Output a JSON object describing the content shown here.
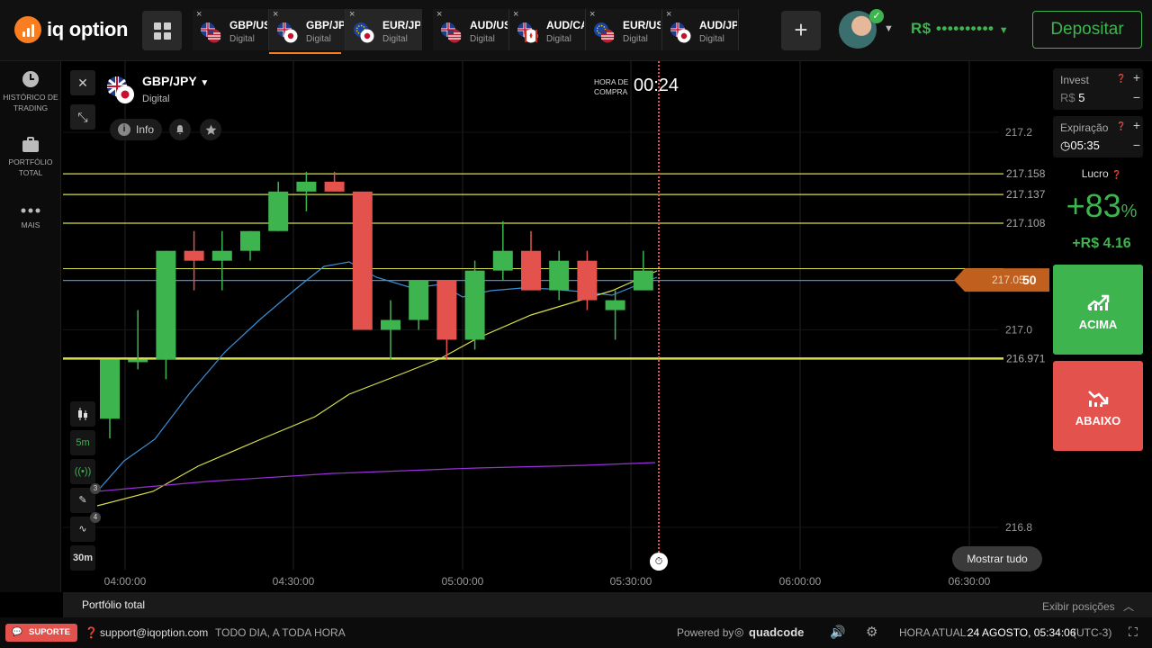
{
  "brand": {
    "name": "iq option"
  },
  "topbar": {
    "tabs": [
      {
        "pair": "GBP/USD",
        "type": "Digital",
        "flag": "gb-us",
        "state": "normal"
      },
      {
        "pair": "GBP/JPY",
        "type": "Digital",
        "flag": "gb-jp",
        "state": "active"
      },
      {
        "pair": "EUR/JPY",
        "type": "Digital",
        "flag": "eu-jp",
        "state": "hover"
      },
      {
        "pair": "AUD/USD",
        "type": "Digital",
        "flag": "au-us",
        "state": "normal"
      },
      {
        "pair": "AUD/CAD",
        "type": "Digital",
        "flag": "au-ca",
        "state": "normal"
      },
      {
        "pair": "EUR/USD",
        "type": "Digital",
        "flag": "eu-us",
        "state": "normal"
      },
      {
        "pair": "AUD/JPY",
        "type": "Digital",
        "flag": "au-jp",
        "state": "normal"
      }
    ],
    "tab_close": "×",
    "add_tab": "+",
    "balance": "R$ ••••••••••",
    "deposit": "Depositar"
  },
  "sidebar": {
    "items": [
      {
        "label": "HISTÓRICO DE TRADING",
        "icon": "clock-icon"
      },
      {
        "label": "PORTFÓLIO TOTAL",
        "icon": "briefcase-icon"
      },
      {
        "label": "MAIS",
        "icon": "more-icon"
      }
    ]
  },
  "asset": {
    "name": "GBP/JPY",
    "type": "Digital",
    "info": "Info"
  },
  "purchase": {
    "label": "HORA DE COMPRA",
    "time": "00:24"
  },
  "tools": {
    "timeframe": "5m",
    "interval": "30m",
    "draw_badge": "3",
    "indicator_badge": "4"
  },
  "chart_data": {
    "type": "candlestick",
    "x_ticks": [
      "04:00:00",
      "04:30:00",
      "05:00:00",
      "05:30:00",
      "06:00:00",
      "06:30:00"
    ],
    "y_ticks": [
      "217.2",
      "217.0",
      "216.8"
    ],
    "level_labels": [
      "217.158",
      "217.137",
      "217.108",
      "216.971"
    ],
    "current_price": {
      "main": "217.05",
      "tail": "50"
    },
    "candles": [
      {
        "t": "04:00",
        "o": 216.91,
        "h": 216.97,
        "l": 216.89,
        "c": 216.97
      },
      {
        "t": "04:05",
        "o": 216.97,
        "h": 217.02,
        "l": 216.96,
        "c": 216.97
      },
      {
        "t": "04:10",
        "o": 216.97,
        "h": 217.08,
        "l": 216.95,
        "c": 217.08
      },
      {
        "t": "04:15",
        "o": 217.08,
        "h": 217.1,
        "l": 217.04,
        "c": 217.07
      },
      {
        "t": "04:20",
        "o": 217.07,
        "h": 217.1,
        "l": 217.04,
        "c": 217.08
      },
      {
        "t": "04:25",
        "o": 217.08,
        "h": 217.1,
        "l": 217.07,
        "c": 217.1
      },
      {
        "t": "04:30",
        "o": 217.1,
        "h": 217.15,
        "l": 217.1,
        "c": 217.14
      },
      {
        "t": "04:35",
        "o": 217.14,
        "h": 217.16,
        "l": 217.12,
        "c": 217.15
      },
      {
        "t": "04:40",
        "o": 217.15,
        "h": 217.16,
        "l": 217.14,
        "c": 217.14
      },
      {
        "t": "04:45",
        "o": 217.14,
        "h": 217.14,
        "l": 217.0,
        "c": 217.0
      },
      {
        "t": "04:50",
        "o": 217.0,
        "h": 217.03,
        "l": 216.97,
        "c": 217.01
      },
      {
        "t": "04:55",
        "o": 217.01,
        "h": 217.05,
        "l": 217.0,
        "c": 217.05
      },
      {
        "t": "05:00",
        "o": 217.05,
        "h": 217.05,
        "l": 216.97,
        "c": 216.99
      },
      {
        "t": "05:05",
        "o": 216.99,
        "h": 217.07,
        "l": 216.98,
        "c": 217.06
      },
      {
        "t": "05:10",
        "o": 217.06,
        "h": 217.11,
        "l": 217.05,
        "c": 217.08
      },
      {
        "t": "05:15",
        "o": 217.08,
        "h": 217.1,
        "l": 217.04,
        "c": 217.04
      },
      {
        "t": "05:20",
        "o": 217.04,
        "h": 217.08,
        "l": 217.03,
        "c": 217.07
      },
      {
        "t": "05:25",
        "o": 217.07,
        "h": 217.08,
        "l": 217.02,
        "c": 217.03
      },
      {
        "t": "05:30",
        "o": 217.02,
        "h": 217.04,
        "l": 216.99,
        "c": 217.03
      },
      {
        "t": "05:35",
        "o": 217.04,
        "h": 217.08,
        "l": 217.04,
        "c": 217.06
      }
    ]
  },
  "chart_controls": {
    "show_all": "Mostrar tudo"
  },
  "trade": {
    "invest_label": "Invest",
    "invest_currency": "R$",
    "invest_value": "5",
    "expiry_label": "Expiração",
    "expiry_value": "05:35",
    "profit_label": "Lucro",
    "profit_pct": "+83",
    "profit_pct_sign": "%",
    "profit_amount": "+R$ 4.16",
    "up_label": "ACIMA",
    "down_label": "ABAIXO",
    "up_color": "#3eb44e",
    "down_color": "#e3524d"
  },
  "portfolio_bar": {
    "title": "Portfólio total",
    "toggle": "Exibir posições"
  },
  "footer": {
    "support_label": "SUPORTE",
    "email": "support@iqoption.com",
    "hours": "TODO DIA, A TODA HORA",
    "powered_by": "Powered by",
    "powered_brand": "quadcode",
    "time_label": "HORA ATUAL:",
    "time_value": "24 AGOSTO, 05:34:06",
    "timezone": "(UTC-3)"
  }
}
